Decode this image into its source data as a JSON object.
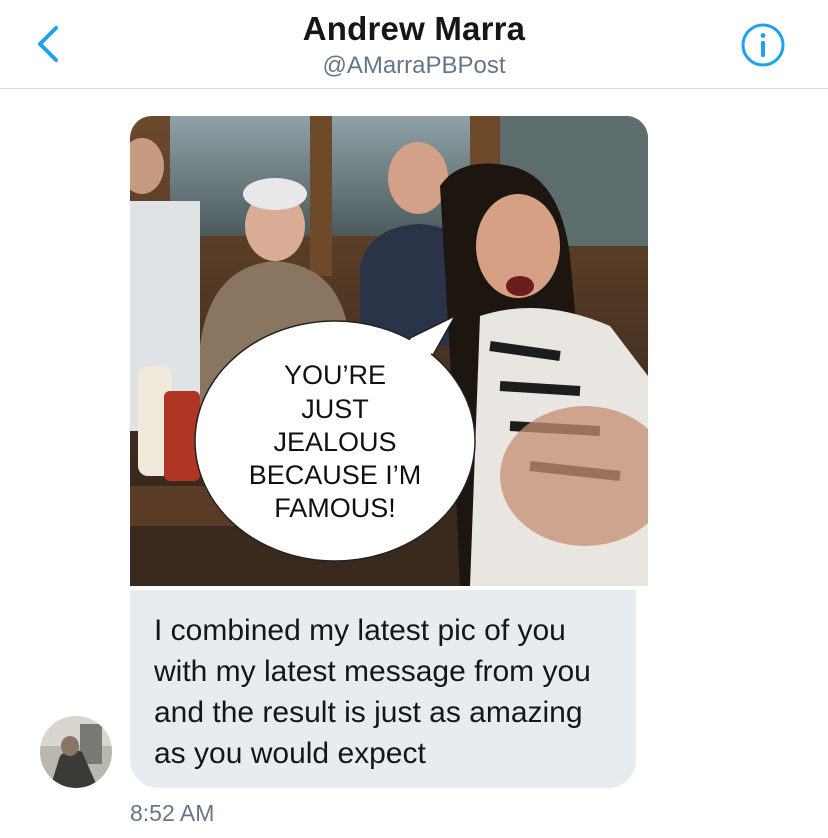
{
  "header": {
    "name": "Andrew Marra",
    "handle": "@AMarraPBPost",
    "back_icon": "chevron-left-icon",
    "info_icon": "info-icon",
    "accent_color": "#1da1f2"
  },
  "message": {
    "image_caption_lines": [
      "YOU’RE",
      "JUST",
      "JEALOUS",
      "BECAUSE I’M",
      "FAMOUS!"
    ],
    "text": "I combined my latest pic of you with my latest message from you and the result is just as amazing as you would expect",
    "timestamp": "8:52 AM",
    "bubble_color": "#e6ecf0"
  }
}
